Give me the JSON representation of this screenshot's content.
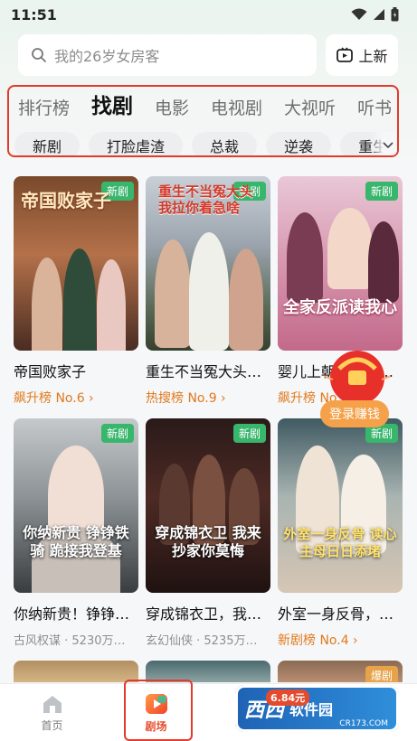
{
  "status": {
    "time": "11:51"
  },
  "search": {
    "placeholder": "我的26岁女房客",
    "new_label": "上新"
  },
  "tabs": [
    "排行榜",
    "找剧",
    "电影",
    "电视剧",
    "大视听",
    "听书"
  ],
  "chips": [
    "新剧",
    "打脸虐渣",
    "总裁",
    "逆袭",
    "重生"
  ],
  "cards": [
    {
      "title": "帝国败家子",
      "poster_text": "帝国败家子",
      "badge": "新剧",
      "sub": "飙升榜 No.6 ›",
      "sub_type": "rank"
    },
    {
      "title": "重生不当冤大头…",
      "poster_text": "重生不当冤大头 我拉你着急啥",
      "badge": "新剧",
      "sub": "热搜榜 No.9 ›",
      "sub_type": "rank"
    },
    {
      "title": "婴儿上朝，全家反…",
      "poster_text": "全家反派读我心",
      "badge": "新剧",
      "sub": "飙升榜 No.3 ›",
      "sub_type": "rank"
    },
    {
      "title": "你纳新贵！铮铮…",
      "poster_text": "你纳新贵 铮铮铁骑 跪接我登基",
      "badge": "新剧",
      "sub": "古风权谋 · 5230万…",
      "sub_type": "meta"
    },
    {
      "title": "穿成锦衣卫，我…",
      "poster_text": "穿成锦衣卫 我来抄家你莫悔",
      "badge": "新剧",
      "sub": "玄幻仙侠 · 5235万…",
      "sub_type": "meta"
    },
    {
      "title": "外室一身反骨，…",
      "poster_text": "外室一身反骨 读心主母日日添堵",
      "badge": "新剧",
      "sub": "新剧榜 No.4 ›",
      "sub_type": "rank"
    },
    {
      "title": "",
      "poster_text": "",
      "badge": "",
      "sub": "",
      "sub_type": "meta"
    },
    {
      "title": "",
      "poster_text": "",
      "badge": "",
      "sub": "",
      "sub_type": "meta"
    },
    {
      "title": "",
      "poster_text": "",
      "badge": "爆剧",
      "sub": "",
      "sub_type": "meta"
    }
  ],
  "float": {
    "login_reward": "登录赚钱"
  },
  "tabbar": {
    "home": "首页",
    "drama": "剧场"
  },
  "watermark": {
    "price": "6.84元",
    "brand": "西西",
    "brand2": "软件园",
    "url": "CR173.COM"
  }
}
